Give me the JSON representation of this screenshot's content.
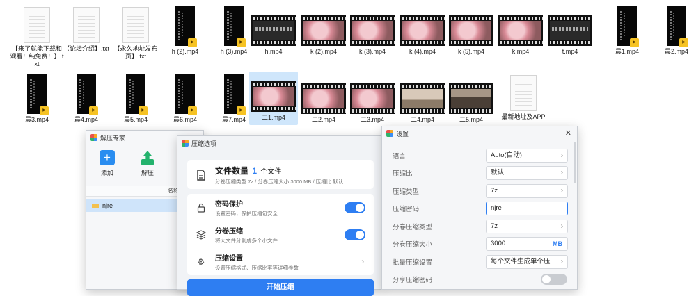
{
  "desktop": {
    "row1": [
      {
        "name": "【来了就能下载和观看！纯免费！】.txt",
        "kind": "doc"
      },
      {
        "name": "【论坛介绍】.txt",
        "kind": "doc"
      },
      {
        "name": "【永久地址发布页】.txt",
        "kind": "doc"
      },
      {
        "name": "h (2).mp4",
        "kind": "vid"
      },
      {
        "name": "h (3).mp4",
        "kind": "vid"
      },
      {
        "name": "h.mp4",
        "kind": "film-dark"
      },
      {
        "name": "k (2).mp4",
        "kind": "film-pink"
      },
      {
        "name": "k (3).mp4",
        "kind": "film-pink"
      },
      {
        "name": "k (4).mp4",
        "kind": "film-pink"
      },
      {
        "name": "k (5).mp4",
        "kind": "film-pink"
      },
      {
        "name": "k.mp4",
        "kind": "film-pink"
      },
      {
        "name": "t.mp4",
        "kind": "film-dark"
      },
      {
        "name": "晨1.mp4",
        "kind": "vid"
      },
      {
        "name": "晨2.mp4",
        "kind": "vid"
      }
    ],
    "row2": [
      {
        "name": "晨3.mp4",
        "kind": "vid"
      },
      {
        "name": "晨4.mp4",
        "kind": "vid"
      },
      {
        "name": "晨5.mp4",
        "kind": "vid"
      },
      {
        "name": "晨6.mp4",
        "kind": "vid"
      },
      {
        "name": "晨7.mp4",
        "kind": "vid"
      },
      {
        "name": "二1.mp4",
        "kind": "film-pink"
      },
      {
        "name": "二2.mp4",
        "kind": "film-pink"
      },
      {
        "name": "二3.mp4",
        "kind": "film-pink"
      },
      {
        "name": "二4.mp4",
        "kind": "film-room"
      },
      {
        "name": "二5.mp4",
        "kind": "film-room2"
      },
      {
        "name": "最新地址及APP",
        "kind": "doc"
      }
    ]
  },
  "extractor": {
    "title": "解压专家",
    "tools": [
      "添加",
      "解压",
      "压"
    ],
    "column_name": "名称",
    "folder": "njre"
  },
  "compress": {
    "title": "压缩选项",
    "file_count_label": "文件数量",
    "file_count": "1",
    "file_count_unit": "个文件",
    "file_count_sub": "分卷压缩类型:7z / 分卷压缩大小:3000 MB / 压缩比:默认",
    "password_title": "密码保护",
    "password_sub": "设置密码，保护压缩包安全",
    "split_title": "分卷压缩",
    "split_sub": "将大文件分割成多个小文件",
    "settings_title": "压缩设置",
    "settings_sub": "设置压缩格式、压缩比率等详细参数",
    "start_button": "开始压缩"
  },
  "settings": {
    "title": "设置",
    "rows": [
      {
        "label": "语言",
        "value": "Auto(自动)"
      },
      {
        "label": "压缩比",
        "value": "默认"
      },
      {
        "label": "压缩类型",
        "value": "7z"
      },
      {
        "label": "压缩密码",
        "value": "njre"
      },
      {
        "label": "分卷压缩类型",
        "value": "7z"
      },
      {
        "label": "分卷压缩大小",
        "value": "3000",
        "unit": "MB"
      },
      {
        "label": "批量压缩设置",
        "value": "每个文件生成单个压..."
      },
      {
        "label": "分享压缩密码",
        "value": ""
      }
    ]
  },
  "colors": {
    "accent": "#2e7ef2",
    "selection": "#cfe6fb"
  }
}
